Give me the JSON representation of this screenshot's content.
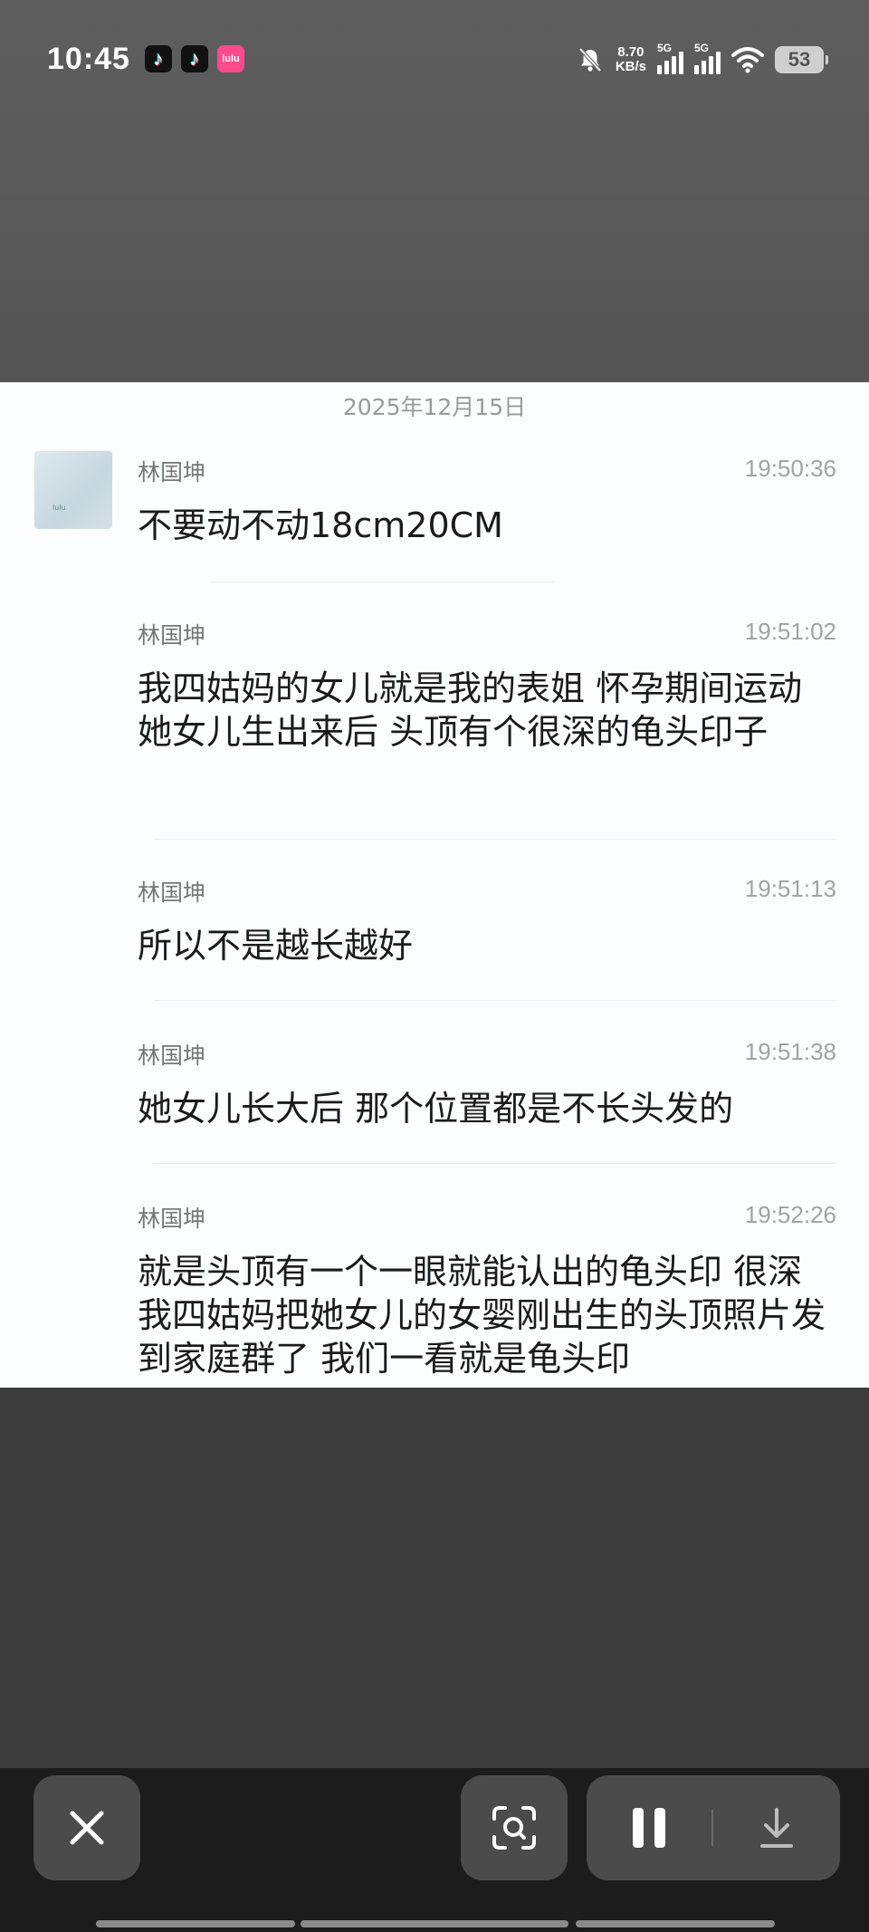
{
  "status_bar": {
    "time": "10:45",
    "apps": [
      "tiktok-icon",
      "tiktok-icon",
      "lulu-icon"
    ],
    "lulu_label": "lulu",
    "net_speed_value": "8.70",
    "net_speed_unit": "KB/s",
    "sim1_label": "5G",
    "sim2_label": "5G",
    "battery": "53"
  },
  "chat": {
    "date": "2025年12月15日",
    "avatar_caption": "lulu",
    "messages": [
      {
        "sender": "林国坤",
        "time": "19:50:36",
        "text": "不要动不动18cm20CM"
      },
      {
        "sender": "林国坤",
        "time": "19:51:02",
        "text": "我四姑妈的女儿就是我的表姐 怀孕期间运动 她女儿生出来后 头顶有个很深的龟头印子"
      },
      {
        "sender": "林国坤",
        "time": "19:51:13",
        "text": "所以不是越长越好"
      },
      {
        "sender": "林国坤",
        "time": "19:51:38",
        "text": "她女儿长大后 那个位置都是不长头发的"
      },
      {
        "sender": "林国坤",
        "time": "19:52:26",
        "text": "就是头顶有一个一眼就能认出的龟头印 很深 我四姑妈把她女儿的女婴刚出生的头顶照片发到家庭群了 我们一看就是龟头印"
      }
    ]
  },
  "toolbar": {
    "close": "close-icon",
    "scan": "scan-icon",
    "pause": "pause-icon",
    "download": "download-icon"
  },
  "colors": {
    "panel_bg": "#fcfdff",
    "toolbar_bg": "#1c1c1c",
    "button_bg": "#4b4b4b"
  }
}
